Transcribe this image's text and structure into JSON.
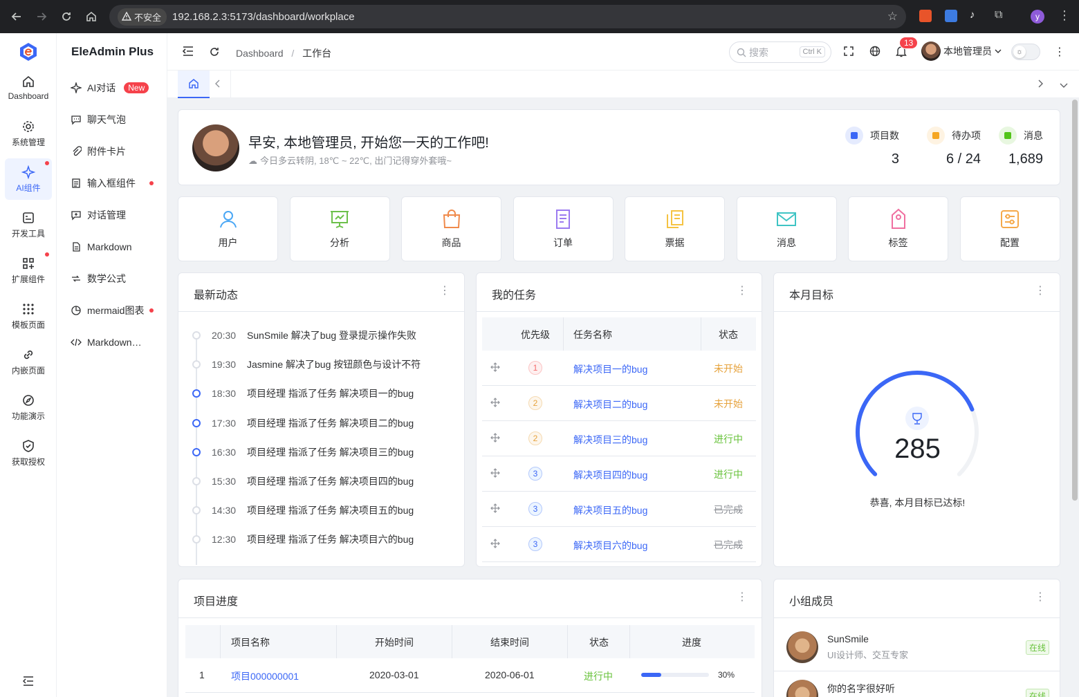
{
  "browser": {
    "security_label": "不安全",
    "url": "192.168.2.3:5173/dashboard/workplace",
    "profile_initial": "y"
  },
  "app": {
    "brand": "EleAdmin Plus"
  },
  "leftnav": [
    {
      "label": "Dashboard",
      "icon": "home-icon"
    },
    {
      "label": "系统管理",
      "icon": "gear-icon"
    },
    {
      "label": "AI组件",
      "icon": "sparkle-icon",
      "active": true
    },
    {
      "label": "开发工具",
      "icon": "tools-icon"
    },
    {
      "label": "扩展组件",
      "icon": "grid-plus-icon"
    },
    {
      "label": "模板页面",
      "icon": "dots-grid-icon"
    },
    {
      "label": "内嵌页面",
      "icon": "link-icon"
    },
    {
      "label": "功能演示",
      "icon": "compass-icon"
    },
    {
      "label": "获取授权",
      "icon": "shield-icon"
    }
  ],
  "subnav": [
    {
      "label": "AI对话",
      "badge": "New"
    },
    {
      "label": "聊天气泡"
    },
    {
      "label": "附件卡片"
    },
    {
      "label": "输入框组件"
    },
    {
      "label": "对话管理"
    },
    {
      "label": "Markdown"
    },
    {
      "label": "数学公式"
    },
    {
      "label": "mermaid图表"
    },
    {
      "label": "Markdown编辑器"
    }
  ],
  "header": {
    "breadcrumb_root": "Dashboard",
    "breadcrumb_sep": "/",
    "breadcrumb_current": "工作台",
    "search_placeholder": "搜索",
    "search_shortcut": "Ctrl K",
    "notify_count": "13",
    "username": "本地管理员"
  },
  "greeting": {
    "title": "早安, 本地管理员, 开始您一天的工作吧!",
    "weather": "今日多云转阴, 18℃ ~ 22℃, 出门记得穿外套哦~",
    "stats": [
      {
        "label": "项目数",
        "value": "3",
        "color": "#3b67f6"
      },
      {
        "label": "待办项",
        "value": "6 / 24",
        "color": "#f5a623"
      },
      {
        "label": "消息",
        "value": "1,689",
        "color": "#52c41a"
      }
    ]
  },
  "quick": [
    {
      "label": "用户",
      "color": "#4aa7f5",
      "icon": "user-icon"
    },
    {
      "label": "分析",
      "color": "#6cc04a",
      "icon": "presentation-icon"
    },
    {
      "label": "商品",
      "color": "#f08a4b",
      "icon": "shopping-bag-icon"
    },
    {
      "label": "订单",
      "color": "#9b7af0",
      "icon": "document-icon"
    },
    {
      "label": "票据",
      "color": "#f5c342",
      "icon": "copy-icon"
    },
    {
      "label": "消息",
      "color": "#3fc4c4",
      "icon": "mail-icon"
    },
    {
      "label": "标签",
      "color": "#f06fa0",
      "icon": "tag-icon"
    },
    {
      "label": "配置",
      "color": "#f5a94a",
      "icon": "settings-card-icon"
    }
  ],
  "activity": {
    "title": "最新动态",
    "items": [
      {
        "time": "20:30",
        "text": "SunSmile 解决了bug 登录提示操作失败",
        "primary": false
      },
      {
        "time": "19:30",
        "text": "Jasmine 解决了bug 按钮颜色与设计不符",
        "primary": false
      },
      {
        "time": "18:30",
        "text": "项目经理 指派了任务 解决项目一的bug",
        "primary": true
      },
      {
        "time": "17:30",
        "text": "项目经理 指派了任务 解决项目二的bug",
        "primary": true
      },
      {
        "time": "16:30",
        "text": "项目经理 指派了任务 解决项目三的bug",
        "primary": true
      },
      {
        "time": "15:30",
        "text": "项目经理 指派了任务 解决项目四的bug",
        "primary": false
      },
      {
        "time": "14:30",
        "text": "项目经理 指派了任务 解决项目五的bug",
        "primary": false
      },
      {
        "time": "12:30",
        "text": "项目经理 指派了任务 解决项目六的bug",
        "primary": false
      }
    ]
  },
  "tasks": {
    "title": "我的任务",
    "columns": [
      "优先级",
      "任务名称",
      "状态"
    ],
    "rows": [
      {
        "priority": "1",
        "name": "解决项目一的bug",
        "status": "未开始",
        "state": "ns"
      },
      {
        "priority": "2",
        "name": "解决项目二的bug",
        "status": "未开始",
        "state": "ns"
      },
      {
        "priority": "2",
        "name": "解决项目三的bug",
        "status": "进行中",
        "state": "ip"
      },
      {
        "priority": "3",
        "name": "解决项目四的bug",
        "status": "进行中",
        "state": "ip"
      },
      {
        "priority": "3",
        "name": "解决项目五的bug",
        "status": "已完成",
        "state": "dn"
      },
      {
        "priority": "3",
        "name": "解决项目六的bug",
        "status": "已完成",
        "state": "dn"
      }
    ]
  },
  "goal": {
    "title": "本月目标",
    "value": "285",
    "progress": 0.75,
    "message": "恭喜, 本月目标已达标!"
  },
  "projects": {
    "title": "项目进度",
    "columns": [
      "项目名称",
      "开始时间",
      "结束时间",
      "状态",
      "进度"
    ],
    "rows": [
      {
        "index": "1",
        "name": "项目000000001",
        "start": "2020-03-01",
        "end": "2020-06-01",
        "status": "进行中",
        "progress": 30,
        "progress_text": "30%"
      }
    ]
  },
  "team": {
    "title": "小组成员",
    "members": [
      {
        "name": "SunSmile",
        "desc": "UI设计师、交互专家",
        "status": "在线"
      },
      {
        "name": "你的名字很好听",
        "desc": "",
        "status": "在线"
      }
    ]
  }
}
